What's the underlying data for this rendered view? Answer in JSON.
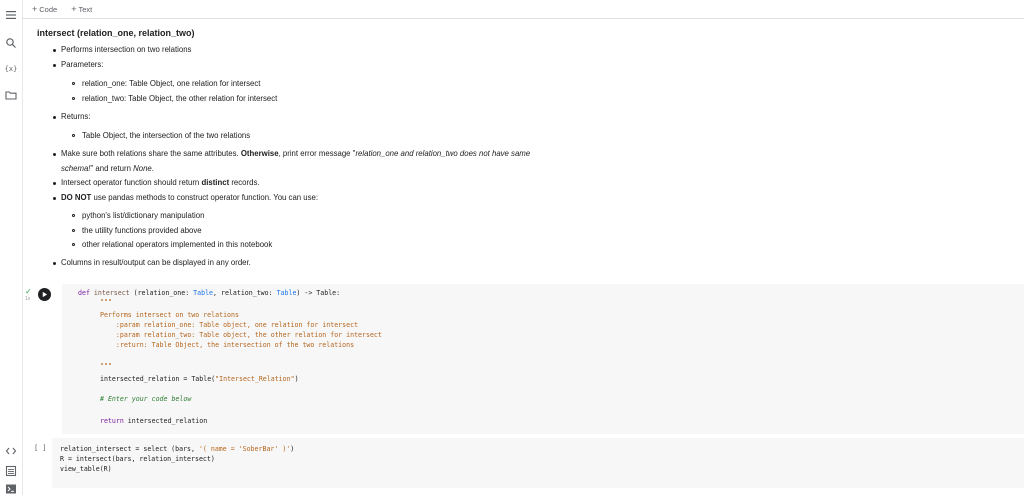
{
  "toolbar": {
    "code_label": "Code",
    "text_label": "Text",
    "plus": "+"
  },
  "sidebar": {
    "icons": [
      "menu-icon",
      "search-icon",
      "variables-icon",
      "files-icon",
      "code-snippets-icon",
      "command-palette-icon",
      "terminal-icon"
    ],
    "variables_glyph": "{x}"
  },
  "markdown": {
    "title": "intersect (relation_one, relation_two)",
    "b1": "Performs intersection on two relations",
    "b2": "Parameters:",
    "b2a": "relation_one: Table Object, one relation for intersect",
    "b2b": "relation_two: Table Object, the other relation for intersect",
    "b3": "Returns:",
    "b3a": "Table Object, the intersection of the two relations",
    "b4_pre": "Make sure both relations share the same attributes. ",
    "b4_bold": "Otherwise",
    "b4_mid": ", print error message \"",
    "b4_ital": "relation_one and relation_two does not have same",
    "b4_line2_ital": "schema!",
    "b4_line2_mid": "\" and return ",
    "b4_line2_ital2": "None",
    "b4_line2_end": ".",
    "b5_pre": "Intersect operator function should return ",
    "b5_bold": "distinct",
    "b5_post": " records.",
    "b6_bold": "DO NOT",
    "b6_post": " use pandas methods to construct operator function. You can use:",
    "b6a": "python's list/dictionary manipulation",
    "b6b": "the utility functions provided above",
    "b6c": "other relational operators implemented in this notebook",
    "b7": "Columns in result/output can be displayed in any order."
  },
  "code1": {
    "exec_count": "1s",
    "l1_def": "def",
    "l1_fn": "intersect",
    "l1_a": " (relation_one: ",
    "l1_t1": "Table",
    "l1_b": ", relation_two: ",
    "l1_t2": "Table",
    "l1_c": ") -> ",
    "l1_t3": "Table",
    "l1_d": ":",
    "l2": "\"\"\"",
    "l3": "Performs intersect on two relations",
    "l4": "    :param relation_one: Table object, one relation for intersect",
    "l5": "    :param relation_two: Table object, the other relation for intersect",
    "l6": "    :return: Table Object, the intersection of the two relations",
    "l7": "\"\"\"",
    "l8_a": "intersected_relation = ",
    "l8_t": "Table",
    "l8_b": "(",
    "l8_s": "\"Intersect_Relation\"",
    "l8_c": ")",
    "l9": "# Enter your code below",
    "l10_kw": "return",
    "l10_rest": " intersected_relation"
  },
  "code2": {
    "bracket": "[ ]",
    "l1_a": "relation_intersect = select (bars, ",
    "l1_s": "'( name = 'SoberBar' )'",
    "l1_b": ")",
    "l2": "R = intersect(bars, relation_intersect)",
    "l3": "view_table(R)"
  }
}
